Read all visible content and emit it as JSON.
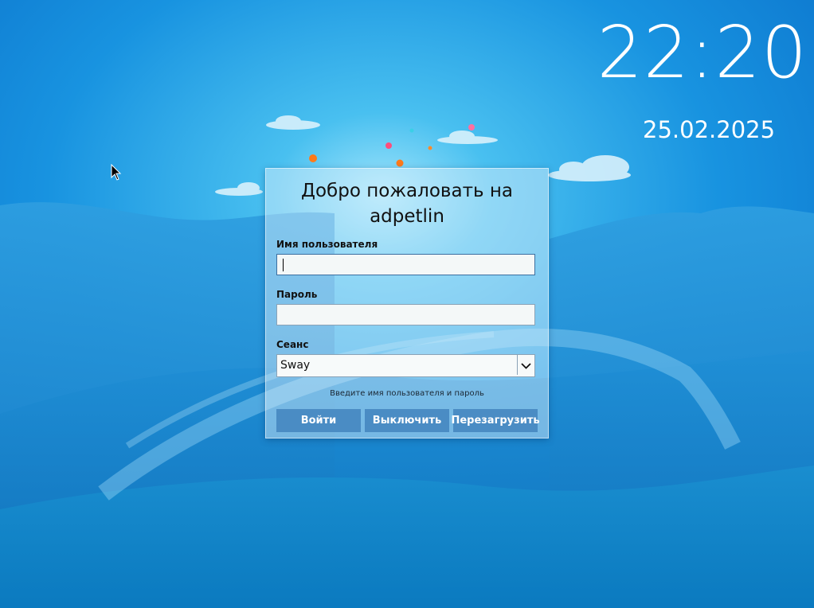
{
  "clock": {
    "time": "22:20",
    "date": "25.02.2025"
  },
  "login": {
    "welcome": "Добро пожаловать на adpetlin",
    "username_label": "Имя пользователя",
    "username_value": "",
    "password_label": "Пароль",
    "password_value": "",
    "session_label": "Сеанс",
    "session_value": "Sway",
    "hint": "Введите имя пользователя и пароль",
    "buttons": {
      "login": "Войти",
      "shutdown": "Выключить",
      "reboot": "Перезагрузить"
    }
  },
  "icons": {
    "cursor": "mouse-pointer-icon",
    "dropdown": "chevron-down-icon"
  },
  "colors": {
    "background": "#1a86d6",
    "button": "#4a8cc4",
    "clock_text": "#ffffff"
  }
}
